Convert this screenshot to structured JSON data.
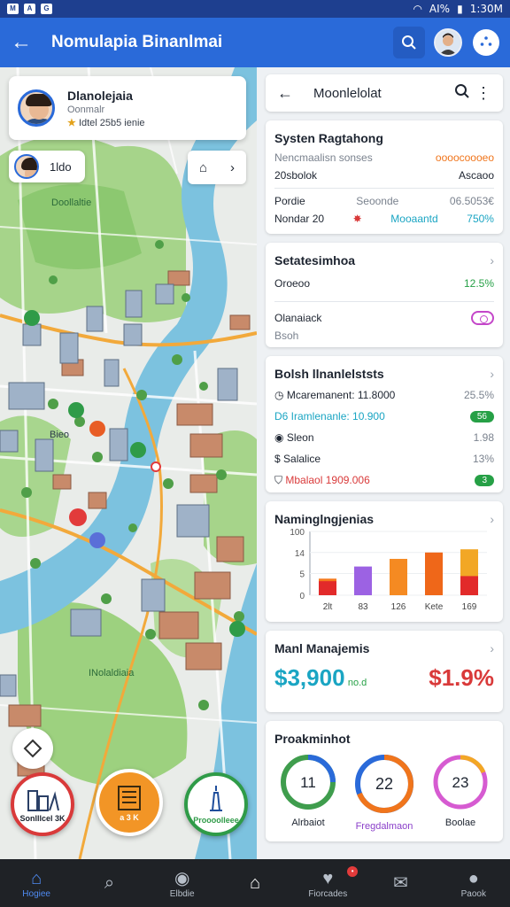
{
  "status_bar": {
    "left_icons": [
      "M",
      "A",
      "G"
    ],
    "right_text": "AI%",
    "time": "1:30M"
  },
  "app_bar": {
    "title": "Nomulapia Binanlmai"
  },
  "map": {
    "profile": {
      "name": "Dlanolejaia",
      "subtitle": "Oonmalr",
      "stats": "Idtel  25b5 ienie"
    },
    "user_chip_label": "1ldo",
    "labels": {
      "park_top": "Doollaltie",
      "park_bottom": "INolaldiaia",
      "kiosk": "Bieo"
    },
    "fab_labels": [
      "Sonlllcel 3K",
      "a 3 K",
      "Proooolleee"
    ]
  },
  "right_panel": {
    "header_title": "Moonlelolat",
    "system": {
      "title": "Systen Ragtahong",
      "rows": [
        {
          "label": "Nencmaalisn sonses",
          "value": "oooocoooeo"
        },
        {
          "label": "20sbolok",
          "value": "Ascaoo"
        },
        {
          "label": "Pordie",
          "mid": "Seoonde",
          "value": "06.5053€"
        },
        {
          "label": "Nondar 20",
          "mid": "Mooaantd",
          "value": "750%"
        }
      ]
    },
    "settings": {
      "title": "Setatesimhoa",
      "rows": [
        {
          "label": "Oroeoo",
          "value": "12.5%"
        },
        {
          "label": "Olanaiack",
          "sub": "Bsoh"
        }
      ]
    },
    "finance": {
      "title": "Bolsh llnanlelststs",
      "rows": [
        {
          "label": "Mcaremanent: 11.8000",
          "value": "25.5%"
        },
        {
          "label": "D6 Iramlenanle: 10.900",
          "value": "56"
        },
        {
          "label": "Sleon",
          "value": "1.98"
        },
        {
          "label": "Salalice",
          "value": "13%"
        },
        {
          "label": "Mbalaol 1909.006",
          "value": "3"
        }
      ]
    },
    "chart_card_title": "Naminglngjenias",
    "management": {
      "title": "Manl Manajemis",
      "left_value": "$3,900",
      "left_suffix": "no.d",
      "right_value": "$1.9%"
    },
    "ranks": {
      "title": "Proakminhot",
      "items": [
        {
          "value": "11",
          "label": "Alrbaiot"
        },
        {
          "value": "22",
          "label": "Fregdalmaon"
        },
        {
          "value": "23",
          "label": "Boolae"
        }
      ]
    }
  },
  "chart_data": {
    "type": "bar",
    "categories": [
      "2lt",
      "83",
      "126",
      "Kete",
      "169"
    ],
    "values": [
      26,
      45,
      57,
      67,
      72
    ],
    "values_low": [
      22,
      0,
      0,
      0,
      30
    ],
    "ylim": [
      0,
      100
    ],
    "yticks": [
      100,
      14,
      5,
      0
    ],
    "colors": [
      "#f57a1e",
      "#9c62e3",
      "#f58a22",
      "#ef6719",
      "#f2a725"
    ],
    "low_color": "#e22a2a"
  },
  "bottom_nav": [
    {
      "label": "Hogiee",
      "icon": "home-icon"
    },
    {
      "label": "",
      "icon": "search-icon"
    },
    {
      "label": "Elbdie",
      "icon": "compass-icon"
    },
    {
      "label": "",
      "icon": "house-icon"
    },
    {
      "label": "Fiorcades",
      "icon": "pin-icon"
    },
    {
      "label": "",
      "icon": "mail-icon"
    },
    {
      "label": "Paook",
      "icon": "profile-icon"
    }
  ],
  "colors": {
    "primary": "#2a6ad9",
    "accent_orange": "#f29526",
    "accent_green": "#26a046",
    "accent_red": "#d93a3a"
  }
}
